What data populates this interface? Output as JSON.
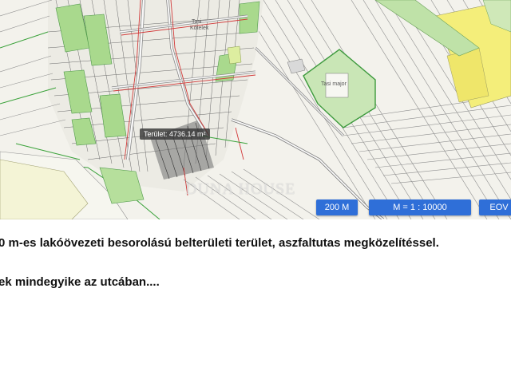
{
  "map": {
    "area_label": "Terület: 4736.14 m²",
    "place_label_1": "Tasi",
    "place_label_2": "Kőtelek",
    "place_label_3": "Tasi major",
    "watermark": "DUNA HOUSE",
    "controls": {
      "scale_bar": "200 M",
      "scale_ratio": "M = 1 : 10000",
      "crs": "EOV"
    }
  },
  "description": {
    "line_1": "0 m-es lakóövezeti besorolású belterületi terület, aszfaltutas megközelítéssel.",
    "line_2": "ek mindegyike az utcában...."
  }
}
